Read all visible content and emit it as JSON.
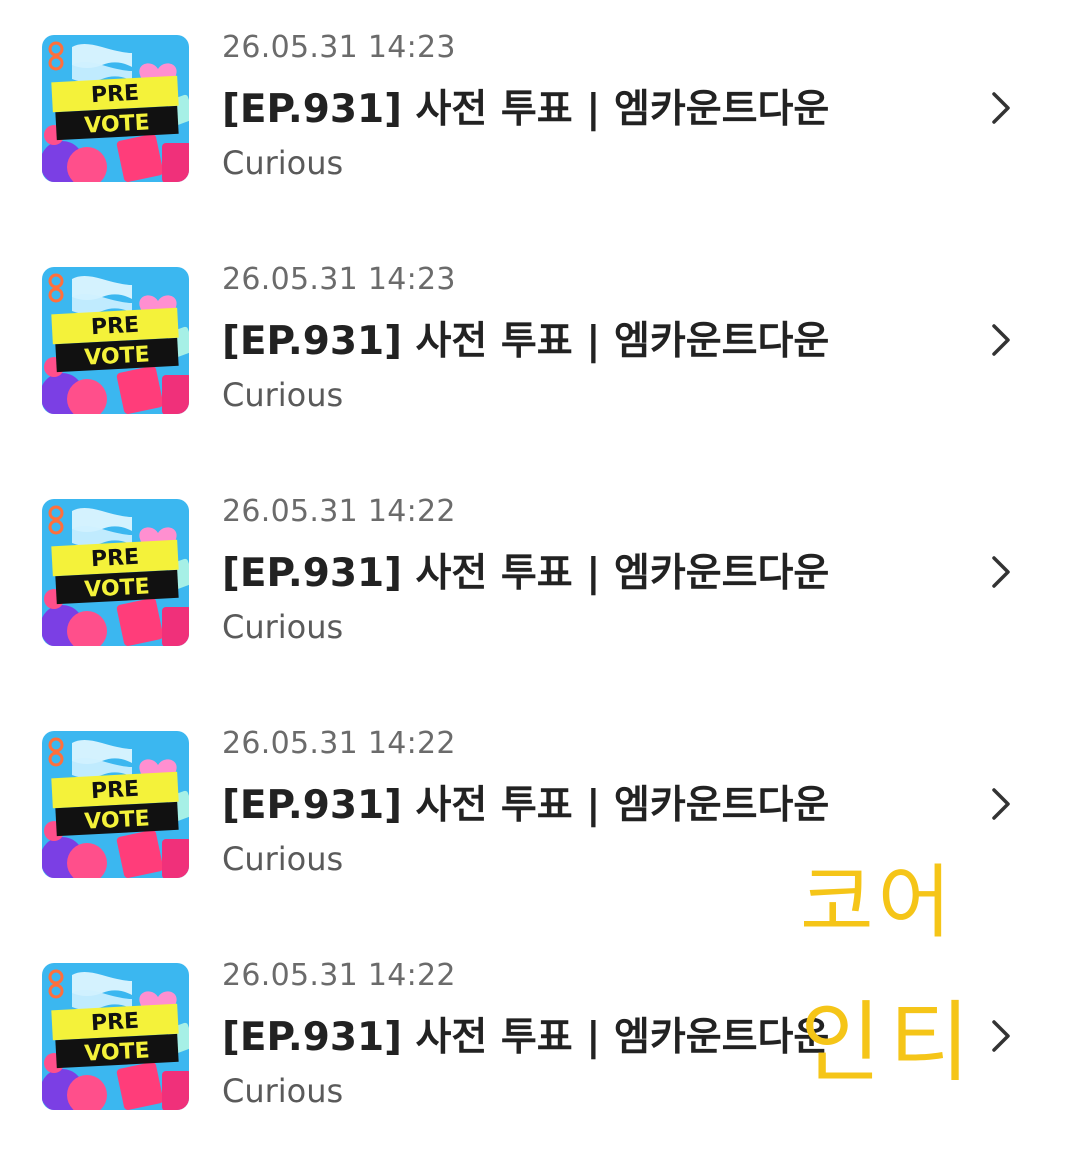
{
  "items": [
    {
      "timestamp": "26.05.31 14:23",
      "title": "[EP.931] 사전 투표 | 엠카운트다운",
      "source": "Curious",
      "thumb_line1": "PRE",
      "thumb_line2": "VOTE",
      "icon": "chevron-right-icon"
    },
    {
      "timestamp": "26.05.31 14:23",
      "title": "[EP.931] 사전 투표 | 엠카운트다운",
      "source": "Curious",
      "thumb_line1": "PRE",
      "thumb_line2": "VOTE",
      "icon": "chevron-right-icon"
    },
    {
      "timestamp": "26.05.31 14:22",
      "title": "[EP.931] 사전 투표 | 엠카운트다운",
      "source": "Curious",
      "thumb_line1": "PRE",
      "thumb_line2": "VOTE",
      "icon": "chevron-right-icon"
    },
    {
      "timestamp": "26.05.31 14:22",
      "title": "[EP.931] 사전 투표 | 엠카운트다운",
      "source": "Curious",
      "thumb_line1": "PRE",
      "thumb_line2": "VOTE",
      "icon": "chevron-right-icon"
    },
    {
      "timestamp": "26.05.31 14:22",
      "title": "[EP.931] 사전 투표 | 엠카운트다운",
      "source": "Curious",
      "thumb_line1": "PRE",
      "thumb_line2": "VOTE",
      "icon": "chevron-right-icon"
    }
  ],
  "watermark": {
    "line1": "코어",
    "line2": "인티",
    "color": "#F5C518"
  },
  "colors": {
    "thumb_bg": "#3BB7F0",
    "thumb_banner": "#F4F23A",
    "thumb_label_bg": "#111111",
    "thumb_pink": "#FF4F8B",
    "thumb_purple": "#7B3FE4"
  }
}
